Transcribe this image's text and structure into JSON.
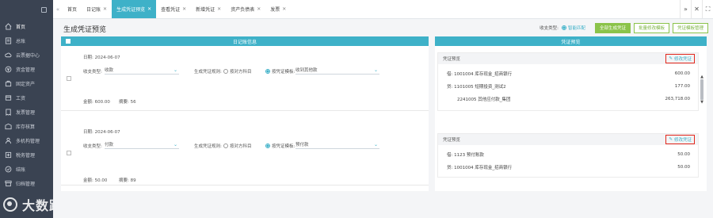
{
  "sidebar": {
    "items": [
      {
        "label": "首页",
        "icon": "home-icon"
      },
      {
        "label": "总账",
        "icon": "ledger-icon"
      },
      {
        "label": "云票据中心",
        "icon": "cloud-ticket-icon"
      },
      {
        "label": "资金管理",
        "icon": "fund-icon"
      },
      {
        "label": "固定资产",
        "icon": "asset-icon"
      },
      {
        "label": "工资",
        "icon": "salary-icon"
      },
      {
        "label": "发票管理",
        "icon": "invoice-icon"
      },
      {
        "label": "库存核算",
        "icon": "inventory-icon"
      },
      {
        "label": "多机构管理",
        "icon": "org-icon"
      },
      {
        "label": "税务管理",
        "icon": "tax-icon"
      },
      {
        "label": "结账",
        "icon": "close-account-icon"
      },
      {
        "label": "归档管理",
        "icon": "archive-icon"
      }
    ]
  },
  "watermark": {
    "text": "大数跨境"
  },
  "tabs": [
    {
      "label": "首页",
      "closable": false,
      "active": false
    },
    {
      "label": "日记账",
      "closable": true,
      "active": false
    },
    {
      "label": "生成凭证预览",
      "closable": true,
      "active": true
    },
    {
      "label": "查看凭证",
      "closable": true,
      "active": false
    },
    {
      "label": "新增凭证",
      "closable": true,
      "active": false
    },
    {
      "label": "资产负债表",
      "closable": true,
      "active": false
    },
    {
      "label": "发票",
      "closable": true,
      "active": false
    }
  ],
  "header": {
    "title": "生成凭证预览",
    "voucher_type_label": "收支类型:",
    "smart_match_label": "智能匹配",
    "buttons": {
      "generate": "全部生成凭证",
      "batch_edit": "批量修改模板",
      "template_manage": "凭证模板管理"
    }
  },
  "left_panel": {
    "title": "日记账信息",
    "entries": [
      {
        "date": "日期: 2024-06-07",
        "type_label": "收支类型:",
        "type_value": "收款",
        "rule_label": "生成凭证规则:",
        "rule_opt1": "按对方科目",
        "rule_opt2": "按凭证模板:",
        "template_value": "收到其他款",
        "amount": "金额: 600.00",
        "summary": "摘要: 56"
      },
      {
        "date": "日期: 2024-06-07",
        "type_label": "收支类型:",
        "type_value": "付款",
        "rule_label": "生成凭证规则:",
        "rule_opt1": "按对方科目",
        "rule_opt2": "按凭证模板:",
        "template_value": "预付款",
        "amount": "金额: 50.00",
        "summary": "摘要: 89"
      }
    ]
  },
  "right_panel": {
    "title": "凭证预览",
    "cards": [
      {
        "head": "凭证预览",
        "edit": "修改凭证",
        "lines": [
          {
            "text": "借: 1001004 库存现金_招商银行",
            "amount": "600.00"
          },
          {
            "text": "贷: 1101005 短期投资_测试2",
            "amount": "177.00"
          },
          {
            "text": "2241005 其他应付款_集团",
            "amount": "263,718.00"
          }
        ]
      },
      {
        "head": "凭证预览",
        "edit": "修改凭证",
        "lines": [
          {
            "text": "借: 1123 预付账款",
            "amount": "50.00"
          },
          {
            "text": "贷: 1001004 库存现金_招商银行",
            "amount": "50.00"
          }
        ]
      }
    ]
  },
  "colors": {
    "sidebar_bg": "#3a4352",
    "accent": "#3eb1c8",
    "green": "#8bc34a",
    "highlight_red": "#e2271c"
  }
}
